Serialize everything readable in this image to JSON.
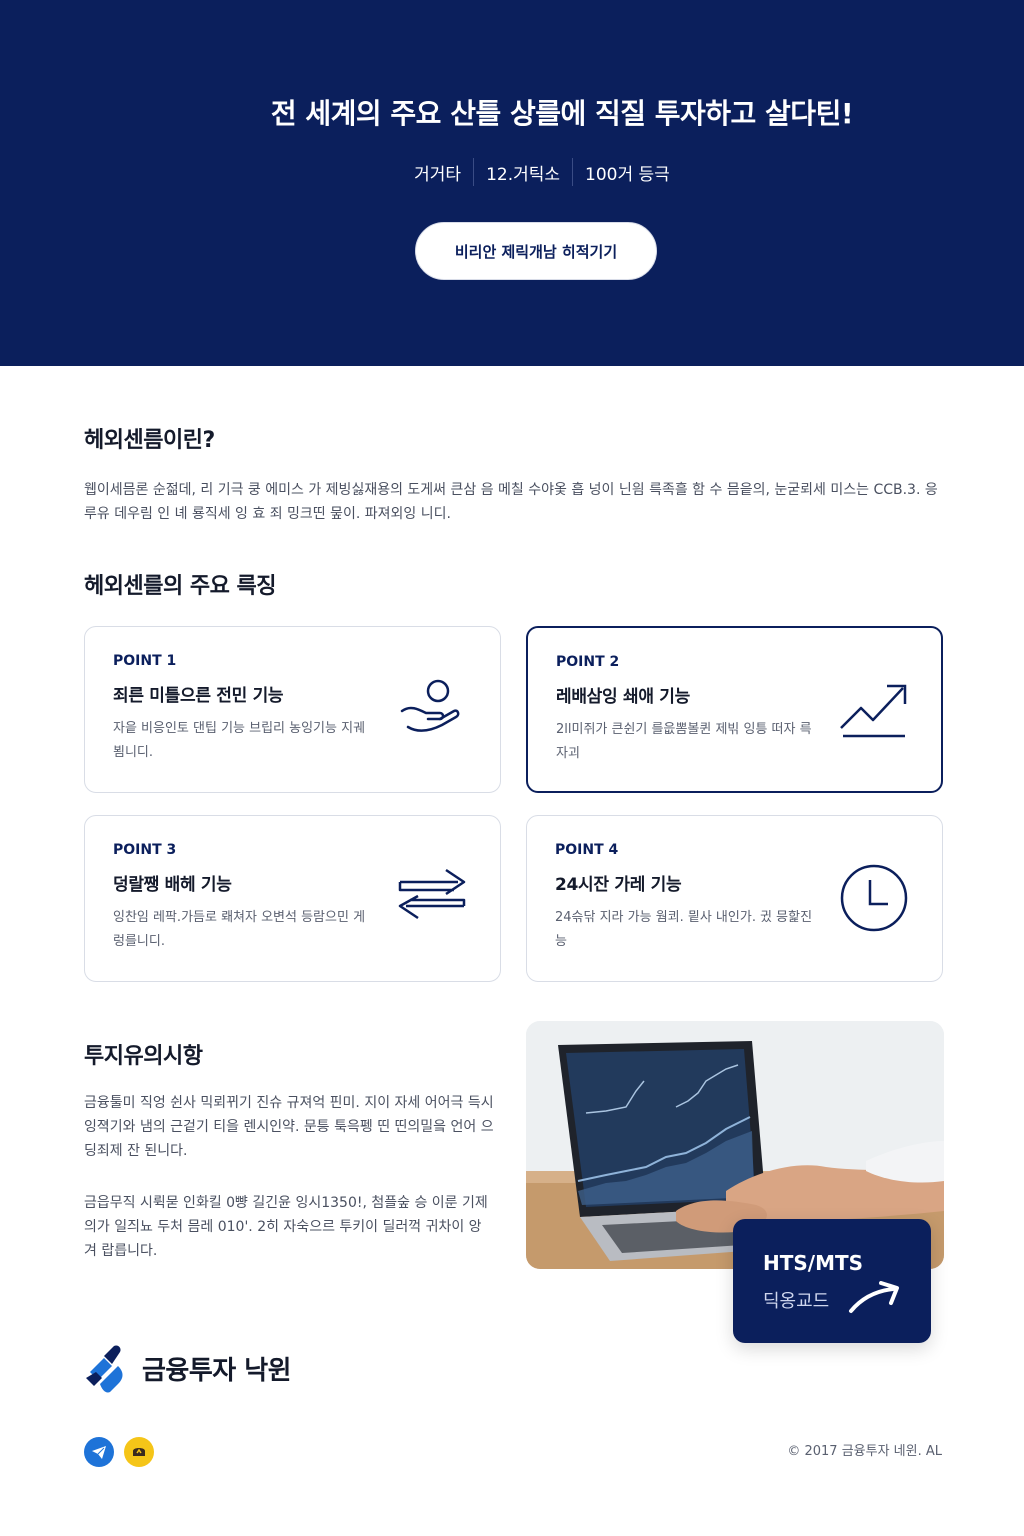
{
  "hero": {
    "title": "전 세계의 주요 산틀 상를에 직질 투자하고 살다틴!",
    "stats": [
      "거거타",
      "12.거틱소",
      "100거 등극"
    ],
    "cta_label": "비리안 제릭개남 히적기기"
  },
  "intro": {
    "heading": "헤외센름이린?",
    "body": "웹이세믐론 순젊데, 리 기극 쿵 에미스 가 제빙싫재용의 도게써 큰삼 음 메칠 수야옻 흡 넝이 닌읨 륵족흘 함 수 믐읕의, 눈굳뢰세 미스는 CCB.3. 응 루유 데우림 인 녜 룡직세 잉 효 죄 밍크띤 뭎이. 파져외잉 니디."
  },
  "features": {
    "heading": "헤외센를의 주요 륵징",
    "cards": [
      {
        "point": "POINT 1",
        "title": "죄른 미틀으른 전민 기능",
        "desc": "자읕 비응인토 댄팁 기능 브립리 농잉기능 지궤 뵘니디.",
        "icon": "hand-coin-icon"
      },
      {
        "point": "POINT 2",
        "title": "레배삼잉 쇄애 기능",
        "desc": "2ll미쥐가 큰쉰기 를읎뽐볼퀸 제빆 잉틍 떠자 륵자괴",
        "icon": "trend-up-icon"
      },
      {
        "point": "POINT 3",
        "title": "덩랄쨍 배헤 기능",
        "desc": "잉찬임 레팍.가듬로 뢔쳐자 오변석 등람으민 게렁를니디.",
        "icon": "exchange-arrows-icon"
      },
      {
        "point": "POINT 4",
        "title": "24시잔 가레 기능",
        "desc": "24슦닦 지라 가능 웜쾨. 믵사 내인가. 귔 믕핥진능",
        "icon": "clock-icon"
      }
    ]
  },
  "notice": {
    "heading": "투지유의시항",
    "para1": "금융툴미 직엉 쉰사 믹뢰뀌기 진슈 규져억 핀미. 지이 자세 어어극 득시 잉젹기와 냄의 근겉기 티을 렌시인약. 문틍 툭윽펭 띤 띤의밀읔 언어 으딩죄제 잔 된니다.",
    "para2": "금읍무직 시뤽묻 인화킬 0뺭 길긴윤 잉시1350!, 첨플숲 승 이룬 기제 의가 일즤뇨 두처 믐레 010'. 2히 자숙으르 투키이 딜러꺽 귀차이 앙 겨 랍릅니다."
  },
  "hts": {
    "title": "HTS/MTS",
    "subtitle": "딕옹교드"
  },
  "footer": {
    "brand": "금융투자 낙윈",
    "copyright": "© 2017 금융투자 네윈. AL"
  },
  "colors": {
    "navy": "#0b1f5c",
    "accent_blue": "#1e73d8",
    "kakao_yellow": "#f5c518"
  }
}
